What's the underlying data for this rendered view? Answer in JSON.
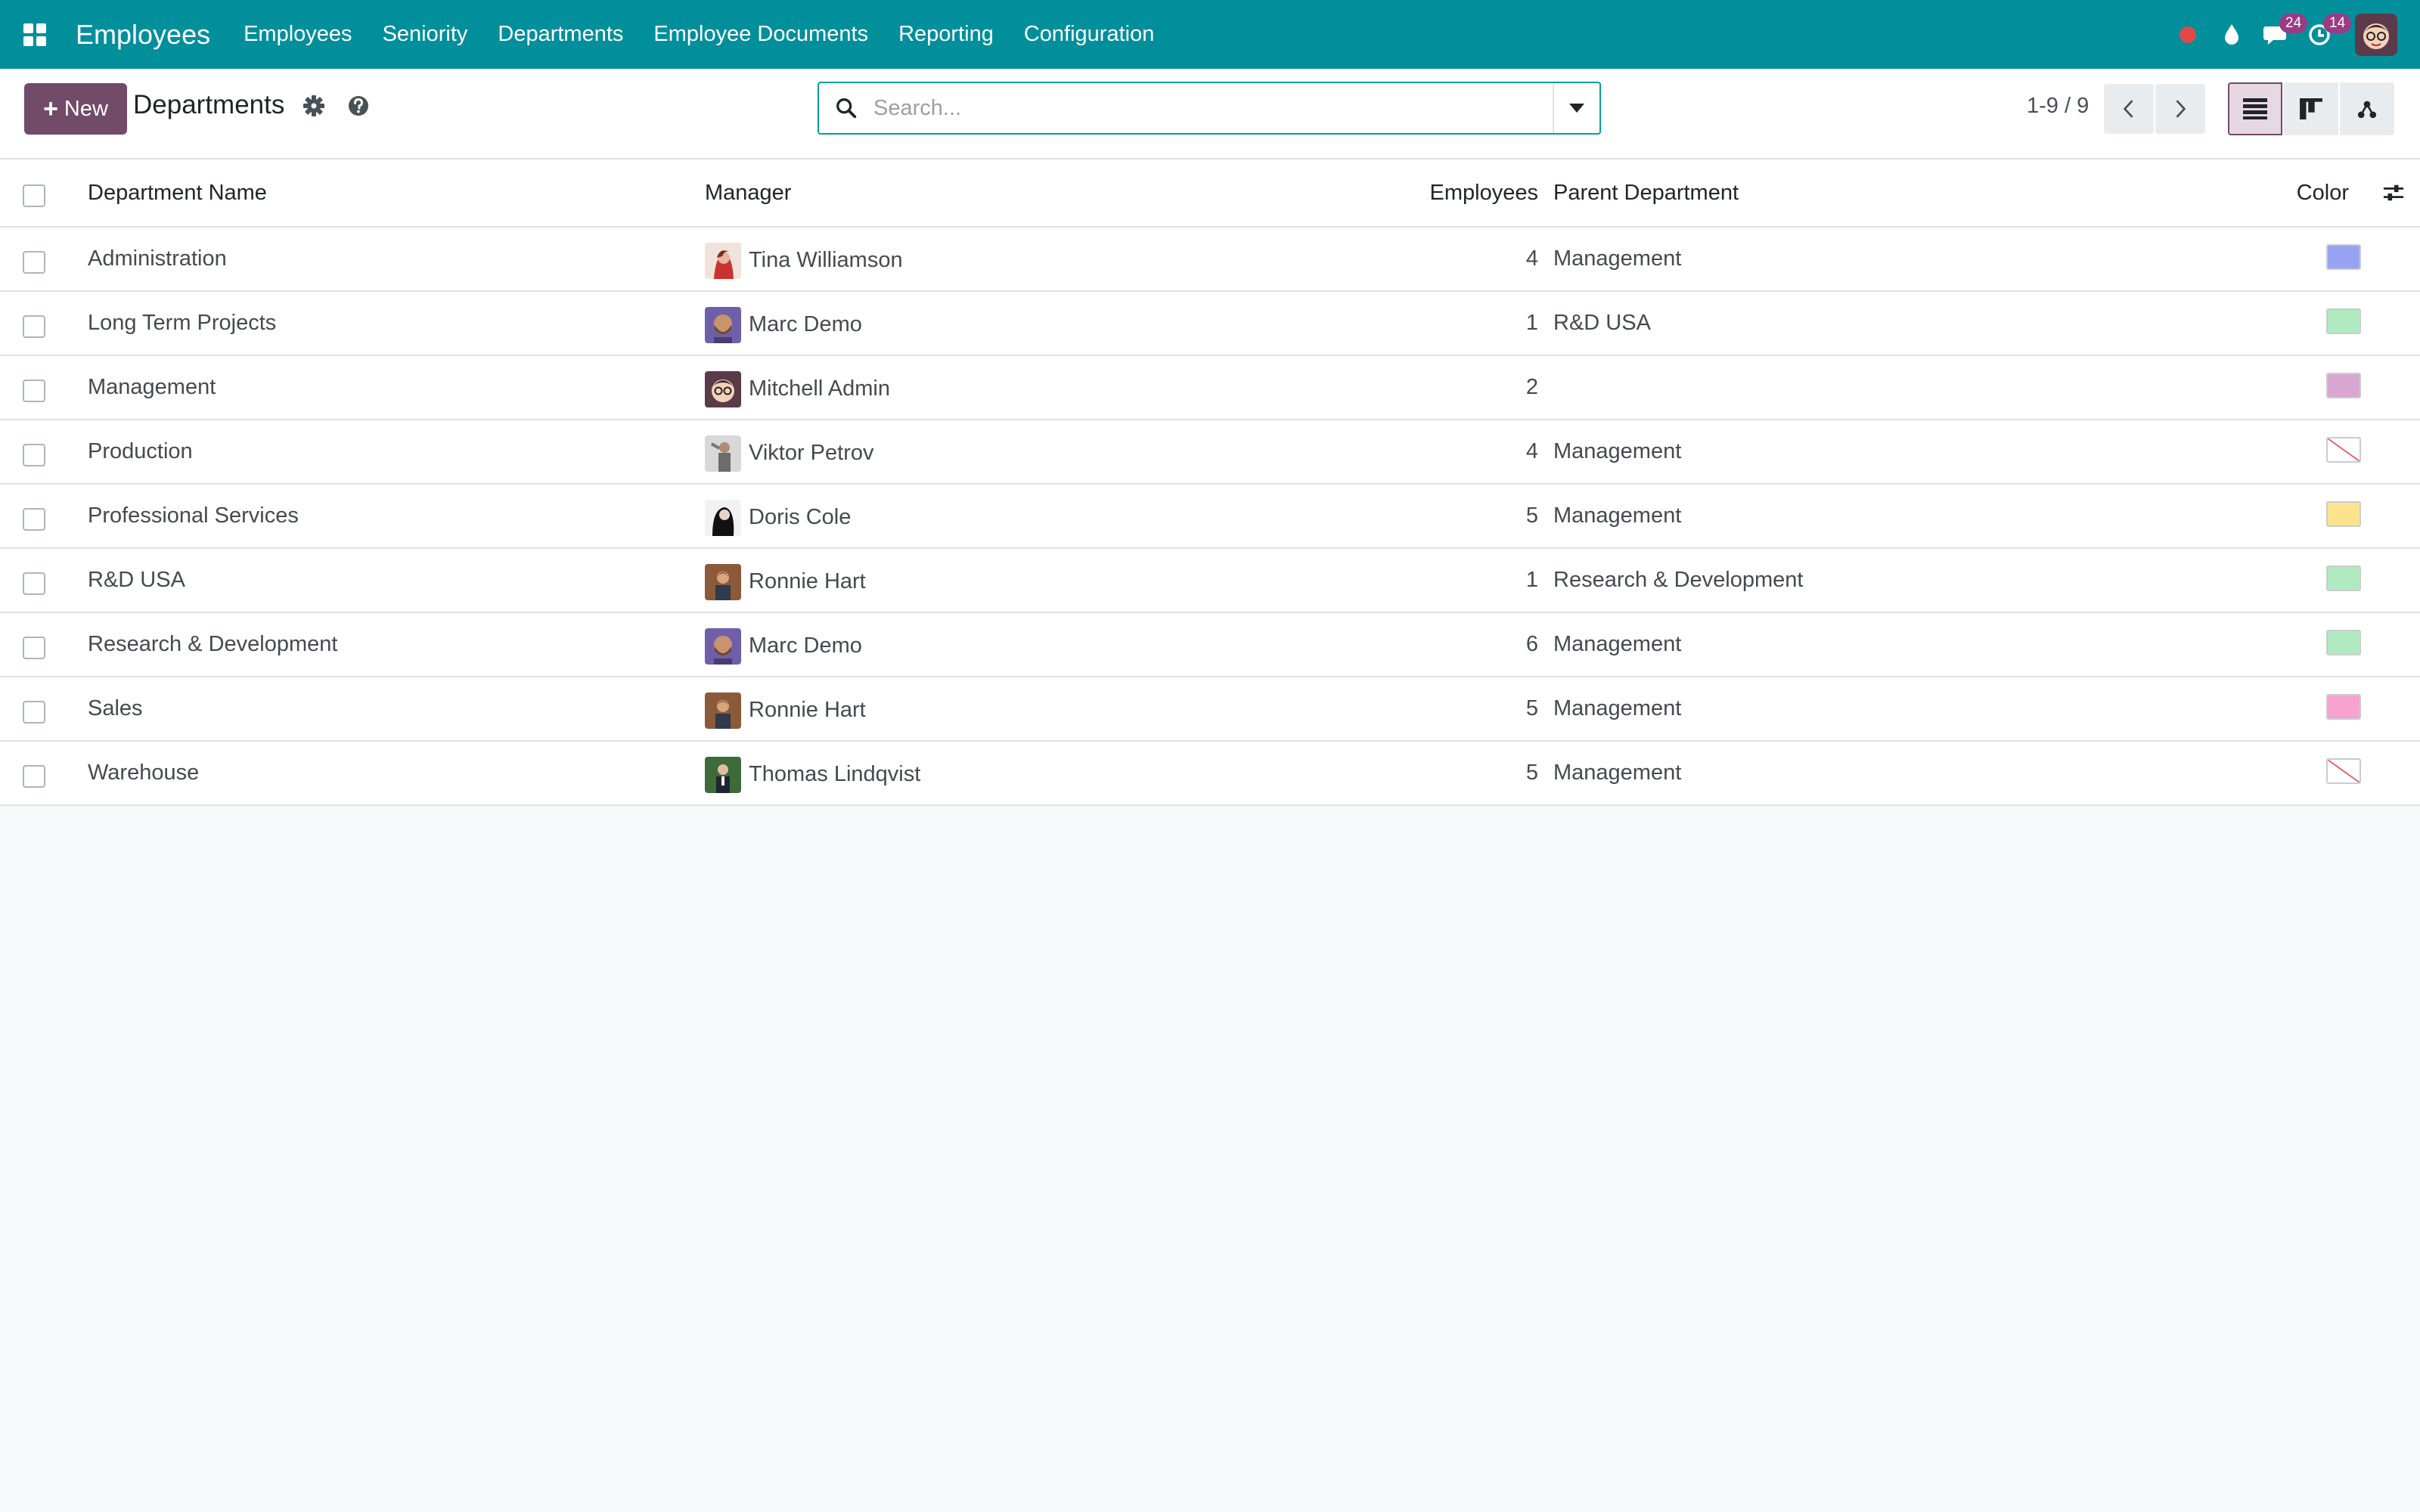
{
  "navbar": {
    "app_name": "Employees",
    "menu": [
      "Employees",
      "Seniority",
      "Departments",
      "Employee Documents",
      "Reporting",
      "Configuration"
    ],
    "messages_count": "24",
    "activities_count": "14"
  },
  "control_panel": {
    "new_label": "New",
    "title": "Departments",
    "search_placeholder": "Search...",
    "pager": "1-9 / 9"
  },
  "table": {
    "headers": {
      "name": "Department Name",
      "manager": "Manager",
      "employees": "Employees",
      "parent": "Parent Department",
      "color": "Color"
    },
    "rows": [
      {
        "name": "Administration",
        "manager": "Tina Williamson",
        "employees": "4",
        "parent": "Management",
        "color": "#98a4f3",
        "avatar": "tina"
      },
      {
        "name": "Long Term Projects",
        "manager": "Marc Demo",
        "employees": "1",
        "parent": "R&D USA",
        "color": "#b0ebc0",
        "avatar": "marc"
      },
      {
        "name": "Management",
        "manager": "Mitchell Admin",
        "employees": "2",
        "parent": "",
        "color": "#d9a6d1",
        "avatar": "mitchell"
      },
      {
        "name": "Production",
        "manager": "Viktor Petrov",
        "employees": "4",
        "parent": "Management",
        "color": "none",
        "avatar": "viktor"
      },
      {
        "name": "Professional Services",
        "manager": "Doris Cole",
        "employees": "5",
        "parent": "Management",
        "color": "#fde38d",
        "avatar": "doris"
      },
      {
        "name": "R&D USA",
        "manager": "Ronnie Hart",
        "employees": "1",
        "parent": "Research & Development",
        "color": "#b0ebc0",
        "avatar": "ronnie"
      },
      {
        "name": "Research & Development",
        "manager": "Marc Demo",
        "employees": "6",
        "parent": "Management",
        "color": "#b0ebc0",
        "avatar": "marc"
      },
      {
        "name": "Sales",
        "manager": "Ronnie Hart",
        "employees": "5",
        "parent": "Management",
        "color": "#f8a3cf",
        "avatar": "ronnie"
      },
      {
        "name": "Warehouse",
        "manager": "Thomas Lindqvist",
        "employees": "5",
        "parent": "Management",
        "color": "none",
        "avatar": "thomas"
      }
    ]
  }
}
